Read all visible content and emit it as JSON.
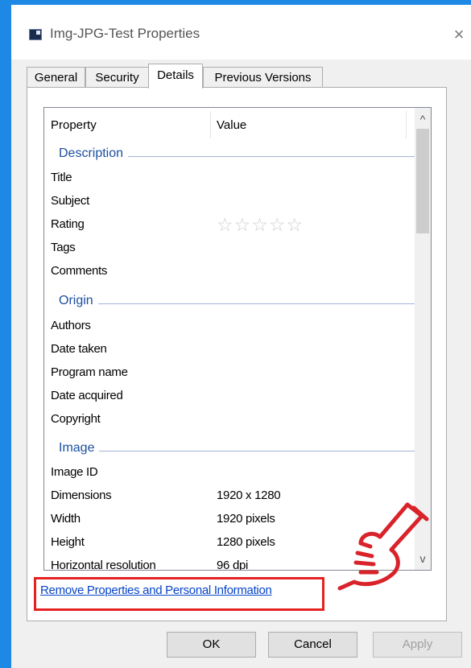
{
  "window": {
    "title": "Img-JPG-Test Properties",
    "icon": "image-file-icon",
    "close_symbol": "×"
  },
  "tabs": [
    {
      "label": "General"
    },
    {
      "label": "Security"
    },
    {
      "label": "Details"
    },
    {
      "label": "Previous Versions"
    }
  ],
  "active_tab": "Details",
  "list": {
    "columns": {
      "property": "Property",
      "value": "Value"
    },
    "groups": {
      "description": "Description",
      "origin": "Origin",
      "image": "Image"
    },
    "rows": {
      "title": {
        "property": "Title",
        "value": ""
      },
      "subject": {
        "property": "Subject",
        "value": ""
      },
      "rating": {
        "property": "Rating",
        "value": "",
        "stars_filled": 0,
        "stars_total": 5
      },
      "tags": {
        "property": "Tags",
        "value": ""
      },
      "comments": {
        "property": "Comments",
        "value": ""
      },
      "authors": {
        "property": "Authors",
        "value": ""
      },
      "date_taken": {
        "property": "Date taken",
        "value": ""
      },
      "program_name": {
        "property": "Program name",
        "value": ""
      },
      "date_acquired": {
        "property": "Date acquired",
        "value": ""
      },
      "copyright": {
        "property": "Copyright",
        "value": ""
      },
      "image_id": {
        "property": "Image ID",
        "value": ""
      },
      "dimensions": {
        "property": "Dimensions",
        "value": "1920 x 1280"
      },
      "width": {
        "property": "Width",
        "value": "1920 pixels"
      },
      "height": {
        "property": "Height",
        "value": "1280 pixels"
      },
      "horizontal_resolution": {
        "property": "Horizontal resolution",
        "value": "96 dpi"
      }
    },
    "scroll": {
      "up_symbol": "^",
      "down_symbol": "v"
    }
  },
  "remove_link": "Remove Properties and Personal Information",
  "buttons": {
    "ok": "OK",
    "cancel": "Cancel",
    "apply": "Apply"
  },
  "colors": {
    "background_blue": "#1e88e5",
    "group_header": "#1c4fa0",
    "link": "#0645c8",
    "highlight_red": "#e52222"
  }
}
